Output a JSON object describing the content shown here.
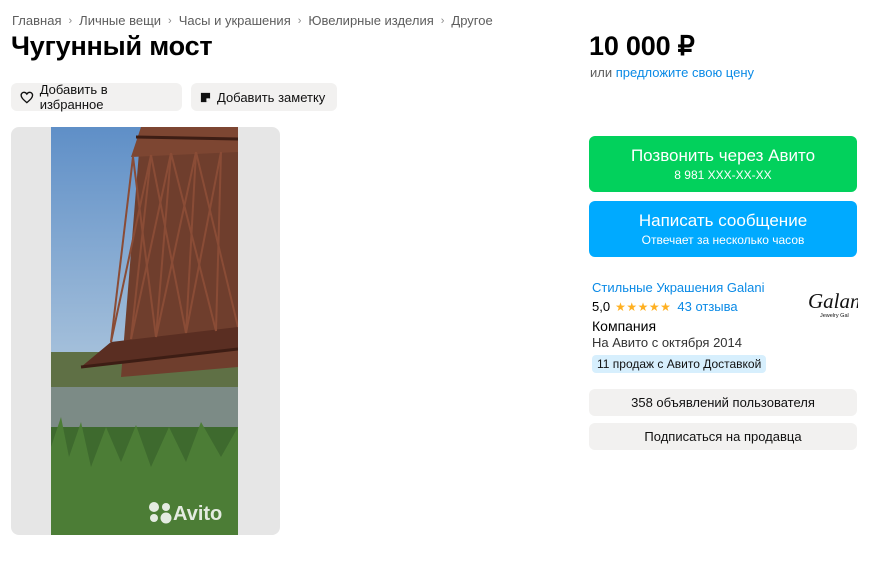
{
  "breadcrumb": [
    "Главная",
    "Личные вещи",
    "Часы и украшения",
    "Ювелирные изделия",
    "Другое"
  ],
  "title": "Чугунный мост",
  "actions": {
    "favorite_label": "Добавить в избранное",
    "note_label": "Добавить заметку"
  },
  "gallery": {
    "watermark": "Avito"
  },
  "price": {
    "value": "10 000 ₽",
    "or_text": "или",
    "offer_link": "предложите свою цену"
  },
  "call_button": {
    "label": "Позвонить через Авито",
    "phone": "8 981 XXX-XX-XX"
  },
  "message_button": {
    "label": "Написать сообщение",
    "sub": "Отвечает за несколько часов"
  },
  "seller": {
    "name": "Стильные Украшения Galani",
    "rating": "5,0",
    "stars": "★★★★★",
    "reviews": "43 отзыва",
    "type": "Компания",
    "since": "На Авито с октября 2014",
    "delivery_badge": "11 продаж с Авито Доставкой",
    "logo_text": "Galani",
    "logo_sub": "Jewelry Gal"
  },
  "listings_button": "358 объявлений пользователя",
  "subscribe_button": "Подписаться на продавца",
  "colors": {
    "call_green": "#02d15c",
    "message_blue": "#00aaff",
    "link_blue": "#0a8ae6",
    "star": "#ffb021"
  }
}
